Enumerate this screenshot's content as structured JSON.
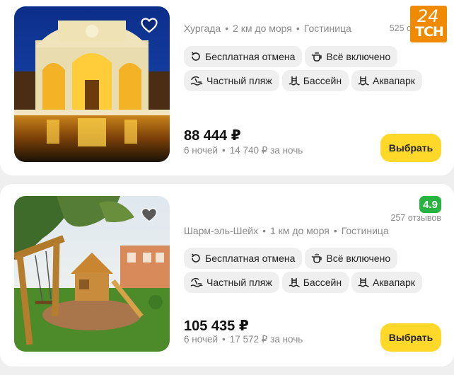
{
  "watermark": {
    "number": "24",
    "text": "ТСН"
  },
  "hotels": [
    {
      "location": "Хургада",
      "distance": "2 км до моря",
      "type": "Гостиница",
      "reviews": "525 о",
      "rating": "",
      "amenities": [
        "Бесплатная отмена",
        "Всё включено",
        "Частный пляж",
        "Бассейн",
        "Аквапарк"
      ],
      "price": "88 444 ₽",
      "nights": "6 ночей",
      "per_night": "14 740 ₽ за ночь",
      "select_label": "Выбрать",
      "favorite_icon": "heart-outline-icon"
    },
    {
      "location": "Шарм-эль-Шейх",
      "distance": "1 км до моря",
      "type": "Гостиница",
      "reviews": "257 отзывов",
      "rating": "4.9",
      "amenities": [
        "Бесплатная отмена",
        "Всё включено",
        "Частный пляж",
        "Бассейн",
        "Аквапарк"
      ],
      "price": "105 435 ₽",
      "nights": "6 ночей",
      "per_night": "17 572 ₽ за ночь",
      "select_label": "Выбрать",
      "favorite_icon": "heart-filled-icon"
    }
  ],
  "colors": {
    "accent": "#ffd829",
    "rating": "#27b33f",
    "tag_bg": "#efefef",
    "muted": "#8a8a8a"
  }
}
